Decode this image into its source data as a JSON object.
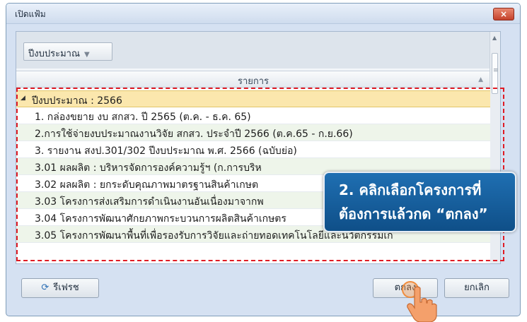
{
  "dialog": {
    "title": "เปิดแฟ้ม",
    "close_label": "×"
  },
  "toolbar": {
    "fiscal_year_select": "ปีงบประมาณ"
  },
  "list": {
    "column_header": "รายการ",
    "group_label": "ปีงบประมาณ : 2566",
    "items": [
      "1. กล่องขยาย งบ สกสว. ปี 2565 (ต.ค. - ธ.ค. 65)",
      "2.การใช้จ่ายงบประมาณงานวิจัย สกสว. ประจำปี 2566 (ต.ค.65 - ก.ย.66)",
      "3. รายงาน สงป.301/302 ปีงบประมาณ พ.ศ. 2566 (ฉบับย่อ)",
      "3.01 ผลผลิต : บริหารจัดการองค์ความรู้ฯ (ก.การบริห",
      "3.02 ผลผลิต : ยกระดับคุณภาพมาตรฐานสินค้าเกษต",
      "3.03 โครงการส่งเสริมการดำเนินงานอันเนื่องมาจากพ",
      "3.04 โครงการพัฒนาศักยภาพกระบวนการผลิตสินค้าเกษตร",
      "3.05 โครงการพัฒนาพื้นที่เพื่อรองรับการวิจัยและถ่ายทอดเทคโนโลยีและนวัตกรรมเก"
    ]
  },
  "callout": {
    "line1": "2. คลิกเลือกโครงการที่",
    "line2": "ต้องการแล้วกด “ตกลง”"
  },
  "buttons": {
    "refresh": "รีเฟรช",
    "ok": "ตกลง",
    "cancel": "ยกเลิก"
  },
  "colors": {
    "accent": "#1f6fb2",
    "highlight": "#e01b24",
    "selected_group": "#fbe7ad"
  }
}
